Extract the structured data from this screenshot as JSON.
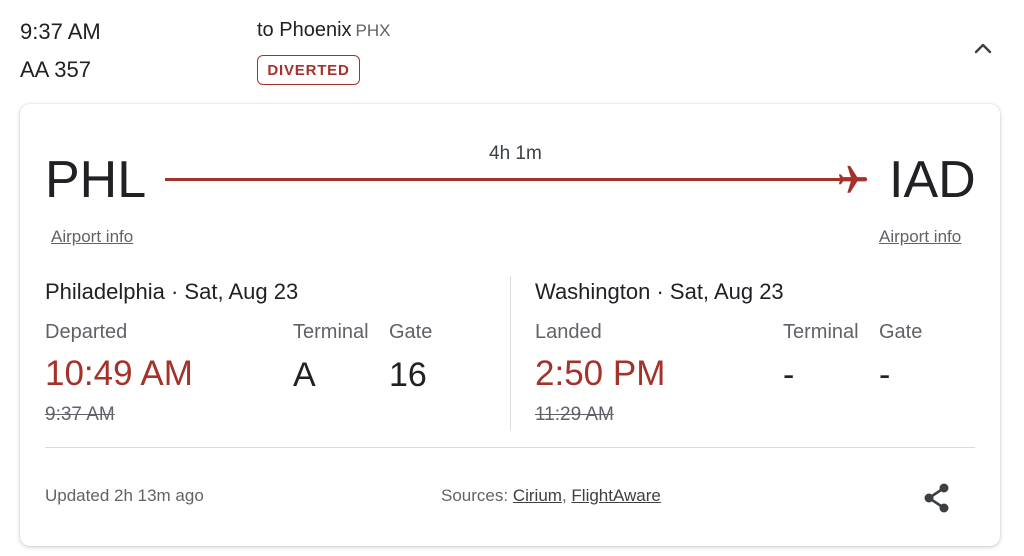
{
  "header": {
    "time": "9:37 AM",
    "flight_number": "AA 357",
    "destination_prefix": "to Phoenix",
    "destination_code": "PHX",
    "status": "DIVERTED",
    "collapse_icon": "chevron-up-icon"
  },
  "route": {
    "origin_code": "PHL",
    "destination_code": "IAD",
    "duration": "4h 1m",
    "origin_link": "Airport info",
    "destination_link": "Airport info",
    "plane_icon": "airplane-icon"
  },
  "departure": {
    "city_date": "Philadelphia · Sat, Aug 23",
    "status_label": "Departed",
    "terminal_label": "Terminal",
    "gate_label": "Gate",
    "actual_time": "10:49 AM",
    "terminal": "A",
    "gate": "16",
    "scheduled_time": "9:37 AM"
  },
  "arrival": {
    "city_date": "Washington · Sat, Aug 23",
    "status_label": "Landed",
    "terminal_label": "Terminal",
    "gate_label": "Gate",
    "actual_time": "2:50 PM",
    "terminal": "-",
    "gate": "-",
    "scheduled_time": "11:29 AM"
  },
  "footer": {
    "updated": "Updated 2h 13m ago",
    "sources_label": "Sources:",
    "source_1": "Cirium",
    "separator": ",",
    "source_2": "FlightAware",
    "share_icon": "share-icon"
  },
  "colors": {
    "accent": "#a5322a",
    "text": "#202124",
    "secondary": "#5f6368",
    "divider": "#dadce0"
  }
}
